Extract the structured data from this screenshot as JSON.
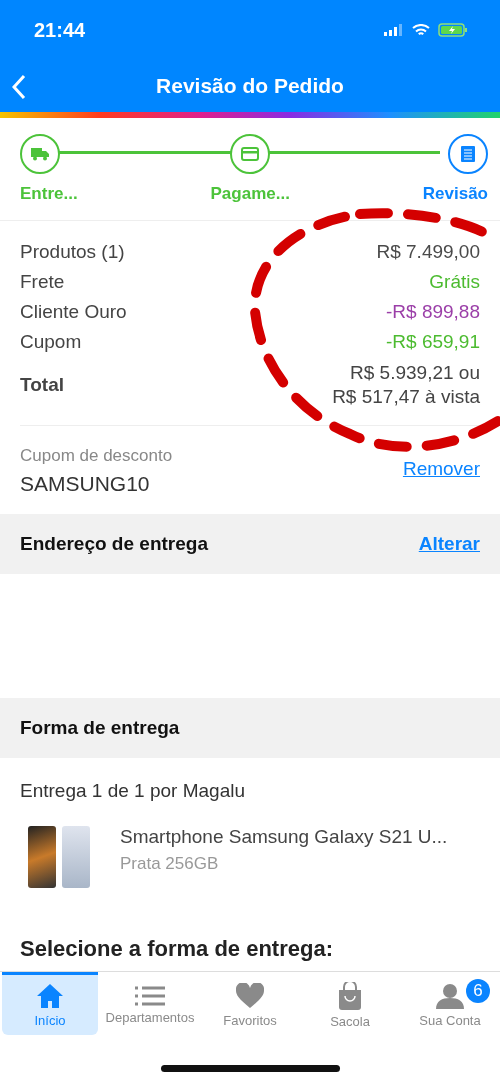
{
  "status_bar": {
    "time": "21:44"
  },
  "header": {
    "title": "Revisão do Pedido"
  },
  "steps": [
    {
      "label": "Entre...",
      "kind": "truck",
      "selected": false
    },
    {
      "label": "Pagame...",
      "kind": "card",
      "selected": false
    },
    {
      "label": "Revisão",
      "kind": "doc",
      "selected": true
    }
  ],
  "summary": [
    {
      "label": "Produtos (1)",
      "value": "R$ 7.499,00",
      "color": "#4a4a4a"
    },
    {
      "label": "Frete",
      "value": "Grátis",
      "color": "#4cbb30"
    },
    {
      "label": "Cliente Ouro",
      "value": "-R$ 899,88",
      "color": "#9b3fa8"
    },
    {
      "label": "Cupom",
      "value": "-R$ 659,91",
      "color": "#4cbb30"
    }
  ],
  "total": {
    "label": "Total",
    "value": "R$ 5.939,21 ou",
    "cash": "R$ 517,47 à vista"
  },
  "coupon": {
    "label": "Cupom de desconto",
    "code": "SAMSUNG10",
    "action": "Remover"
  },
  "address": {
    "title": "Endereço de entrega",
    "action": "Alterar"
  },
  "delivery": {
    "title": "Forma de entrega",
    "shipment": "Entrega 1 de 1 por Magalu",
    "product_name": "Smartphone Samsung Galaxy S21 U...",
    "product_variant": "Prata 256GB",
    "select_heading": "Selecione a forma de entrega:"
  },
  "tab_bar": [
    {
      "label": "Início",
      "kind": "home",
      "selected": true
    },
    {
      "label": "Departamentos",
      "kind": "list",
      "selected": false
    },
    {
      "label": "Favoritos",
      "kind": "heart",
      "selected": false
    },
    {
      "label": "Sacola",
      "kind": "bag",
      "selected": false
    },
    {
      "label": "Sua Conta",
      "kind": "user",
      "selected": false,
      "badge": "6"
    }
  ]
}
